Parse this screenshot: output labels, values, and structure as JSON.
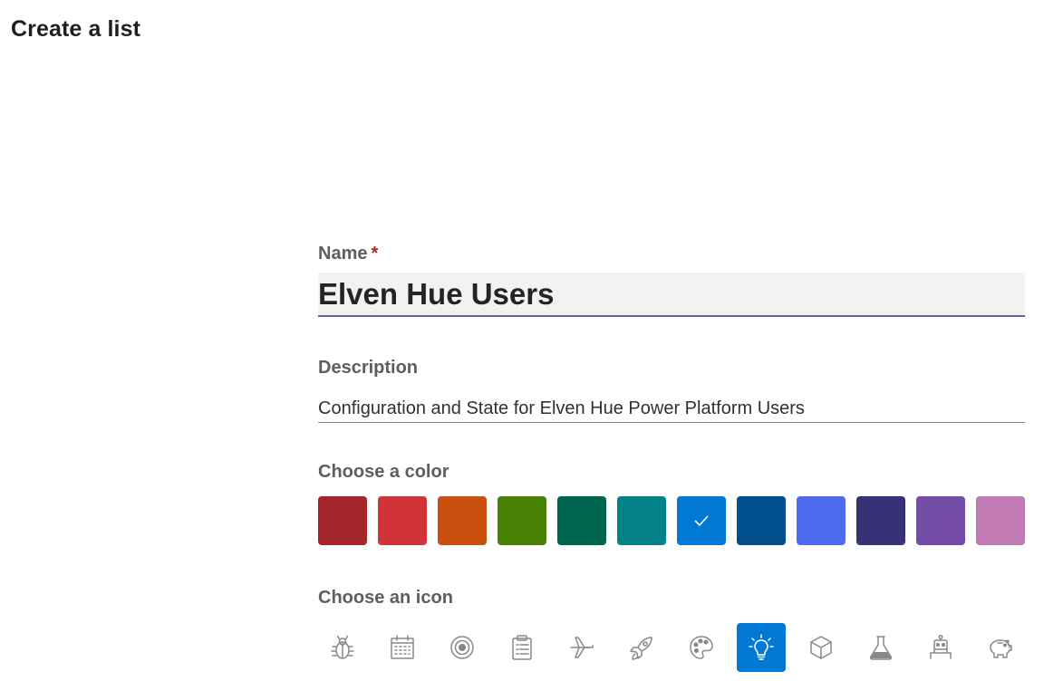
{
  "page": {
    "title": "Create a list"
  },
  "form": {
    "name": {
      "label": "Name",
      "required_marker": "*",
      "value": "Elven Hue Users"
    },
    "description": {
      "label": "Description",
      "value": "Configuration and State for Elven Hue Power Platform Users"
    },
    "color": {
      "label": "Choose a color",
      "selected_index": 6,
      "swatches": [
        "#a4262c",
        "#d13438",
        "#ca5010",
        "#498205",
        "#00654f",
        "#038387",
        "#0078d4",
        "#004e8c",
        "#4f6bed",
        "#373277",
        "#744da9",
        "#c17ab3"
      ]
    },
    "icon": {
      "label": "Choose an icon",
      "selected_index": 7,
      "icons": [
        "bug-icon",
        "calendar-icon",
        "target-icon",
        "clipboard-icon",
        "airplane-icon",
        "rocket-icon",
        "palette-icon",
        "lightbulb-icon",
        "cube-icon",
        "flask-icon",
        "robot-icon",
        "piggy-bank-icon"
      ]
    }
  }
}
